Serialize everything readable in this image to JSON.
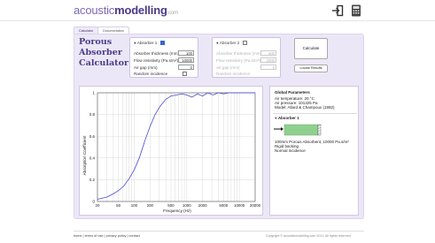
{
  "header": {
    "logo": {
      "part1": "acoustic",
      "part2": "modelling",
      "part3": ".com"
    },
    "icons": [
      "login-icon",
      "calculator-icon"
    ]
  },
  "tabs": [
    {
      "label": "Calculator",
      "active": true
    },
    {
      "label": "Documentation",
      "active": false
    }
  ],
  "title": {
    "line1": "Porous",
    "line2": "Absorber",
    "line3": "Calculator"
  },
  "absorber1": {
    "heading": "Absorber 1",
    "checked": true,
    "fields": [
      {
        "label": "Absorber thickness (mm)",
        "value": "100"
      },
      {
        "label": "Flow resistivity (Pa.s/m²)",
        "value": "10000"
      },
      {
        "label": "Air gap (mm)",
        "value": "0"
      }
    ],
    "random_label": "Random incidence"
  },
  "absorber2": {
    "heading": "Absorber 2",
    "checked": false,
    "fields": [
      {
        "label": "Absorber thickness (mm)",
        "value": "400"
      },
      {
        "label": "Flow resistivity (Pa.s/m²)",
        "value": "2000"
      },
      {
        "label": "Air gap (mm)",
        "value": "0"
      }
    ],
    "random_label": "Random incidence"
  },
  "buttons": {
    "calculate": "Calculate",
    "results": "Locate Results"
  },
  "global": {
    "title": "Global Parameters",
    "lines": [
      "Air temperature: 20 °C",
      "Air pressure: 101325 Pa",
      "Model: Allard & Champoux (1992)"
    ],
    "absorber_title": "Absorber 1",
    "desc": [
      "100mm Porous Absorbent, 10000 Pa.s/m²",
      "Rigid backing",
      "Normal incidence"
    ]
  },
  "footer": {
    "links": [
      "home",
      "terms of use",
      "privacy policy",
      "contact"
    ],
    "copyright": "Copyright © acousticmodelling.com 2011. All rights reserved."
  },
  "colors": {
    "accent": "#4d3c8a",
    "curve": "#4a4ad6",
    "absorber_fill": "#8fd08f"
  },
  "chart_data": {
    "type": "line",
    "ylabel": "Absorption Coefficient",
    "xlabel": "Frequency (Hz)",
    "xscale": "log",
    "xlim": [
      20,
      20000
    ],
    "ylim": [
      0,
      1
    ],
    "x_ticks": [
      20,
      50,
      100,
      200,
      500,
      1000,
      2000,
      5000,
      10000,
      20000
    ],
    "x_tick_labels": [
      "20",
      "50",
      "100",
      "200",
      "500",
      "1000",
      "2000",
      "5000",
      "10000",
      "20000"
    ],
    "y_ticks": [
      0,
      0.2,
      0.4,
      0.6,
      0.8,
      1
    ],
    "y_tick_labels": [
      "0",
      "0.2",
      "0.4",
      "0.6",
      "0.8",
      "1"
    ],
    "grid": true,
    "series": [
      {
        "x": [
          20,
          30,
          40,
          50,
          63,
          80,
          100,
          125,
          160,
          200,
          250,
          315,
          400,
          500,
          630,
          800,
          1000,
          1250,
          1600,
          2000,
          2500,
          3150,
          4000,
          5000,
          6300,
          8000,
          10000,
          12500,
          16000,
          20000
        ],
        "y": [
          0.02,
          0.04,
          0.07,
          0.1,
          0.14,
          0.21,
          0.29,
          0.4,
          0.56,
          0.69,
          0.8,
          0.88,
          0.94,
          0.97,
          0.98,
          0.99,
          0.98,
          0.96,
          0.99,
          0.97,
          1.0,
          0.98,
          1.0,
          0.99,
          1.0,
          1.0,
          1.0,
          1.0,
          1.0,
          1.0
        ]
      }
    ]
  }
}
